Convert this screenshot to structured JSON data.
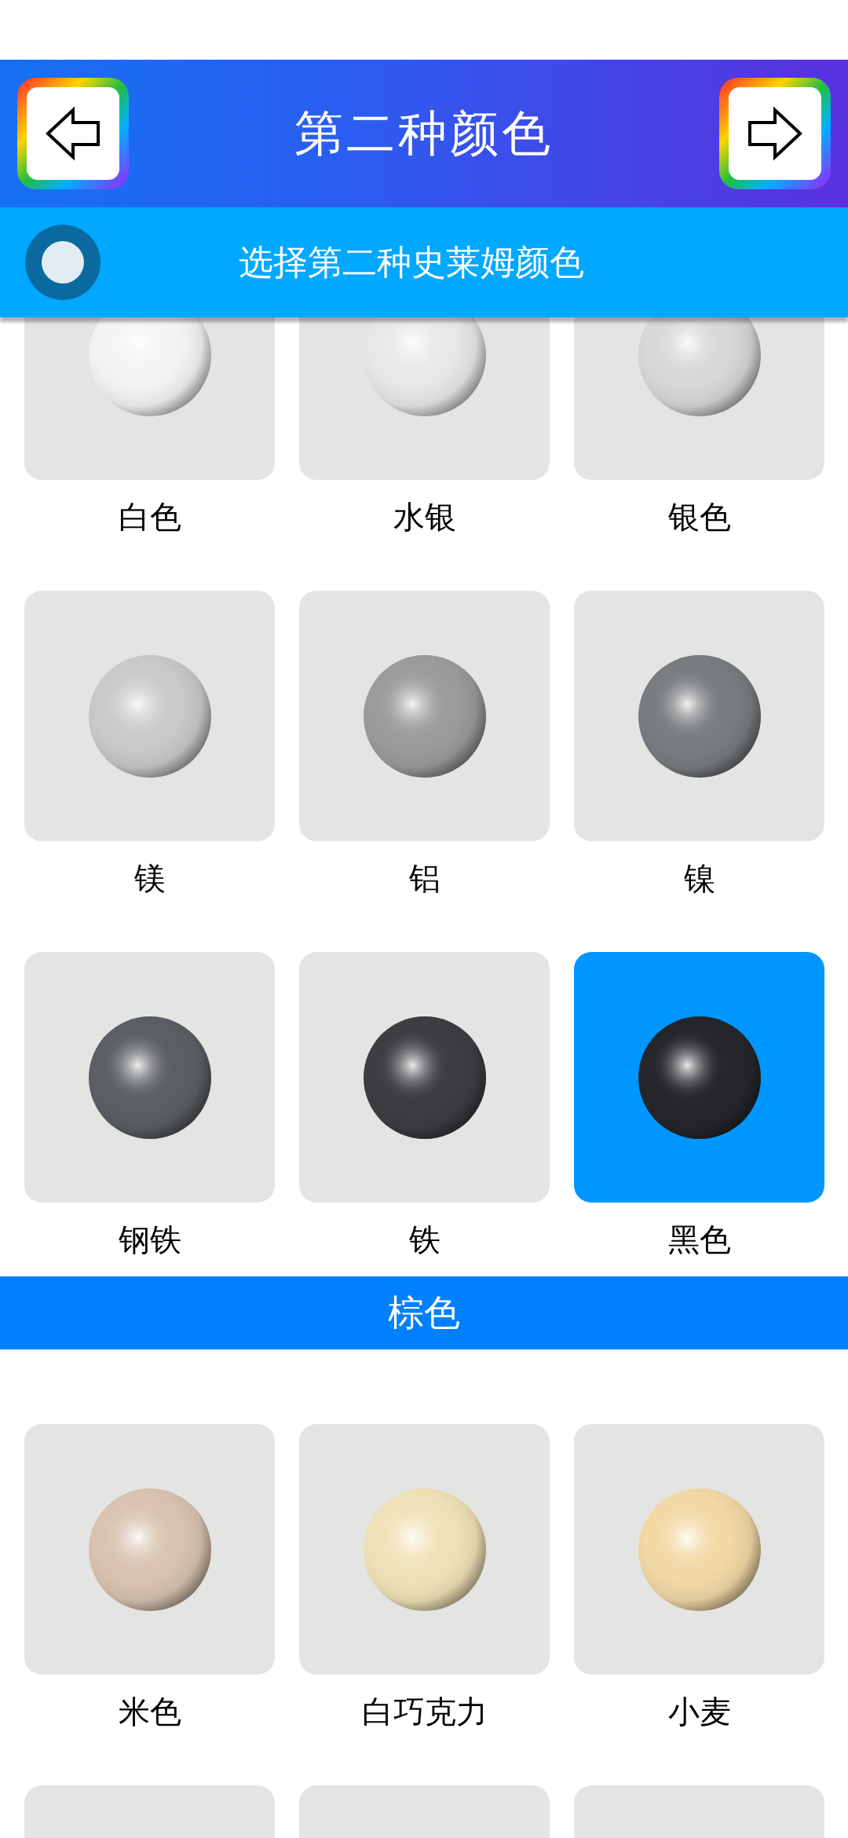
{
  "header": {
    "title": "第二种颜色",
    "back_button": {
      "kind": "arrow-left"
    },
    "next_button": {
      "kind": "arrow-right"
    }
  },
  "subheader": {
    "title": "选择第二种史莱姆颜色"
  },
  "sections": [
    {
      "items": [
        {
          "label": "白色",
          "color": "#f4f4f4",
          "selected": false
        },
        {
          "label": "水银",
          "color": "#e8e8ea",
          "selected": false
        },
        {
          "label": "银色",
          "color": "#d6d8da",
          "selected": false
        },
        {
          "label": "镁",
          "color": "#c8cacc",
          "selected": false
        },
        {
          "label": "铝",
          "color": "#9a9c9e",
          "selected": false
        },
        {
          "label": "镍",
          "color": "#7a7d80",
          "selected": false
        },
        {
          "label": "钢铁",
          "color": "#5c5f63",
          "selected": false
        },
        {
          "label": "铁",
          "color": "#3c3e42",
          "selected": false
        },
        {
          "label": "黑色",
          "color": "#25272b",
          "selected": true
        }
      ]
    },
    {
      "title": "棕色",
      "items": [
        {
          "label": "米色",
          "color": "#d8c4b0",
          "selected": false
        },
        {
          "label": "白巧克力",
          "color": "#f0e2b8",
          "selected": false
        },
        {
          "label": "小麦",
          "color": "#f2d9a6",
          "selected": false
        },
        {
          "selected": false
        },
        {
          "selected": false
        },
        {
          "selected": false
        }
      ]
    }
  ]
}
